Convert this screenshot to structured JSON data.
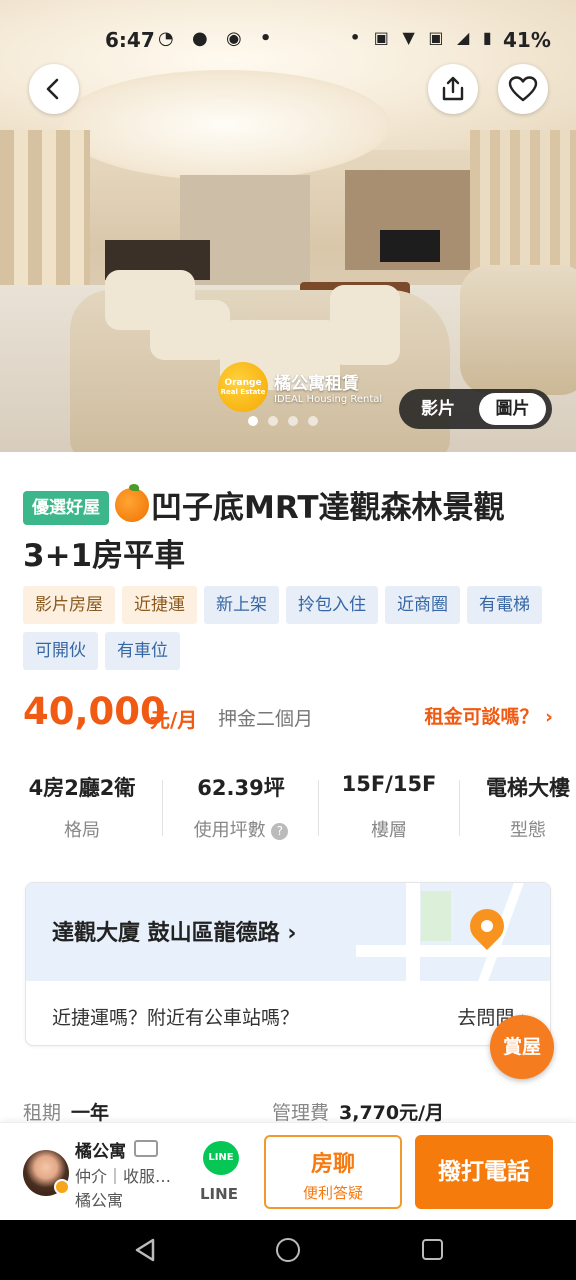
{
  "status_bar": {
    "time": "6:47",
    "battery": "41%"
  },
  "hero": {
    "logo_line1": "橘公寓租賃",
    "logo_line2": "IDEAL Housing Rental",
    "logo_circle_text": "Orange",
    "logo_circle_sub": "Real Estate",
    "media_video": "影片",
    "media_photos": "圖片"
  },
  "listing": {
    "premium_badge": "優選好屋",
    "title": "凹子底MRT達觀森林景觀3+1房平車",
    "tags": [
      {
        "label": "影片房屋",
        "style": "warm"
      },
      {
        "label": "近捷運",
        "style": "warm"
      },
      {
        "label": "新上架",
        "style": "cool"
      },
      {
        "label": "拎包入住",
        "style": "cool"
      },
      {
        "label": "近商圈",
        "style": "cool"
      },
      {
        "label": "有電梯",
        "style": "cool"
      },
      {
        "label": "可開伙",
        "style": "cool"
      },
      {
        "label": "有車位",
        "style": "cool"
      }
    ],
    "price": "40,000",
    "price_unit": "元/月",
    "deposit": "押金二個月",
    "negotiate": "租金可談嗎？",
    "stats": [
      {
        "value": "4房2廳2衛",
        "label": "格局"
      },
      {
        "value": "62.39坪",
        "label": "使用坪數"
      },
      {
        "value": "15F/15F",
        "label": "樓層"
      },
      {
        "value": "電梯大樓",
        "label": "型態"
      }
    ],
    "address": "達觀大廈 鼓山區龍德路",
    "transit_question": "近捷運嗎？附近有公車站嗎？",
    "ask_link": "去問問",
    "fab_label": "賞屋",
    "lease_label": "租期",
    "lease_value": "一年",
    "mgmt_label": "管理費",
    "mgmt_value": "3,770元/月"
  },
  "agent": {
    "name": "橘公寓",
    "role": "仲介｜收服…",
    "company": "橘公寓",
    "line_label": "LINE",
    "line_icon_text": "LINE",
    "chat_title": "房聊",
    "chat_sub": "便利答疑",
    "call": "撥打電話"
  },
  "colors": {
    "accent": "#f57c0c",
    "price": "#f05a12",
    "premium": "#3cb78b",
    "line": "#06c755"
  }
}
